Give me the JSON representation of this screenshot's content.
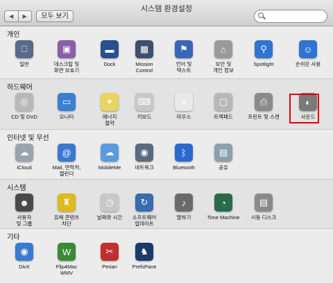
{
  "window": {
    "title": "시스템 환경설정"
  },
  "toolbar": {
    "back": "◀",
    "forward": "▶",
    "show_all": "모두 보기",
    "search_placeholder": ""
  },
  "sections": [
    {
      "title": "개인",
      "items": [
        {
          "label": "일반",
          "icon": "general-icon",
          "color": "#5a6a8a"
        },
        {
          "label": "데스크탑 및\n화면 보호기",
          "icon": "desktop-icon",
          "color": "#8a5ea8"
        },
        {
          "label": "Dock",
          "icon": "dock-icon",
          "color": "#2a4f8f"
        },
        {
          "label": "Mission\nControl",
          "icon": "mission-control-icon",
          "color": "#3d4f6f"
        },
        {
          "label": "언어 및\n텍스트",
          "icon": "language-icon",
          "color": "#3a66b8"
        },
        {
          "label": "보안 및\n개인 정보",
          "icon": "security-icon",
          "color": "#9a9a9a"
        },
        {
          "label": "Spotlight",
          "icon": "spotlight-icon",
          "color": "#2f74d0"
        },
        {
          "label": "손쉬운 사용",
          "icon": "accessibility-icon",
          "color": "#2f74d0"
        }
      ]
    },
    {
      "title": "하드웨어",
      "items": [
        {
          "label": "CD 및 DVD",
          "icon": "cd-icon",
          "color": "#b8b8b8"
        },
        {
          "label": "모니터",
          "icon": "monitor-icon",
          "color": "#3a7fd0"
        },
        {
          "label": "에너지\n절약",
          "icon": "energy-icon",
          "color": "#e8d460"
        },
        {
          "label": "키보드",
          "icon": "keyboard-icon",
          "color": "#c8c8c8"
        },
        {
          "label": "마우스",
          "icon": "mouse-icon",
          "color": "#e8e8e8"
        },
        {
          "label": "트랙패드",
          "icon": "trackpad-icon",
          "color": "#b8b8b8"
        },
        {
          "label": "프린트 및 스캔",
          "icon": "printer-icon",
          "color": "#8a8a8a"
        },
        {
          "label": "사운드",
          "icon": "sound-icon",
          "color": "#7a7a7a"
        }
      ]
    },
    {
      "title": "인터넷 및 무선",
      "items": [
        {
          "label": "iCloud",
          "icon": "icloud-icon",
          "color": "#9aa4b0"
        },
        {
          "label": "Mail, 연락처,\n캘린더",
          "icon": "mail-icon",
          "color": "#3a78d0"
        },
        {
          "label": "MobileMe",
          "icon": "mobileme-icon",
          "color": "#5a9ae0"
        },
        {
          "label": "네트워크",
          "icon": "network-icon",
          "color": "#5a6a80"
        },
        {
          "label": "Bluetooth",
          "icon": "bluetooth-icon",
          "color": "#2a6ad0"
        },
        {
          "label": "공유",
          "icon": "sharing-icon",
          "color": "#8aa0b0"
        }
      ]
    },
    {
      "title": "시스템",
      "items": [
        {
          "label": "사용자\n및 그룹",
          "icon": "users-icon",
          "color": "#4a4a4a"
        },
        {
          "label": "유해 콘텐츠\n차단",
          "icon": "parental-controls-icon",
          "color": "#e0b820"
        },
        {
          "label": "날짜와 시간",
          "icon": "date-time-icon",
          "color": "#c8c8c8"
        },
        {
          "label": "소프트웨어\n업데이트",
          "icon": "software-update-icon",
          "color": "#3a6ab0"
        },
        {
          "label": "말하기",
          "icon": "speech-icon",
          "color": "#6a6a6a"
        },
        {
          "label": "Time Machine",
          "icon": "time-machine-icon",
          "color": "#2a6a4a"
        },
        {
          "label": "시동 디스크",
          "icon": "startup-disk-icon",
          "color": "#8a8a8a"
        }
      ]
    },
    {
      "title": "기타",
      "items": [
        {
          "label": "DivX",
          "icon": "divx-icon",
          "color": "#3a7ad0"
        },
        {
          "label": "Flip4Mac\nWMV",
          "icon": "flip4mac-icon",
          "color": "#3a8a3a"
        },
        {
          "label": "Perian",
          "icon": "perian-icon",
          "color": "#c03030"
        },
        {
          "label": "PrefsPane",
          "icon": "prefspane-icon",
          "color": "#1a3a6a"
        }
      ]
    }
  ]
}
